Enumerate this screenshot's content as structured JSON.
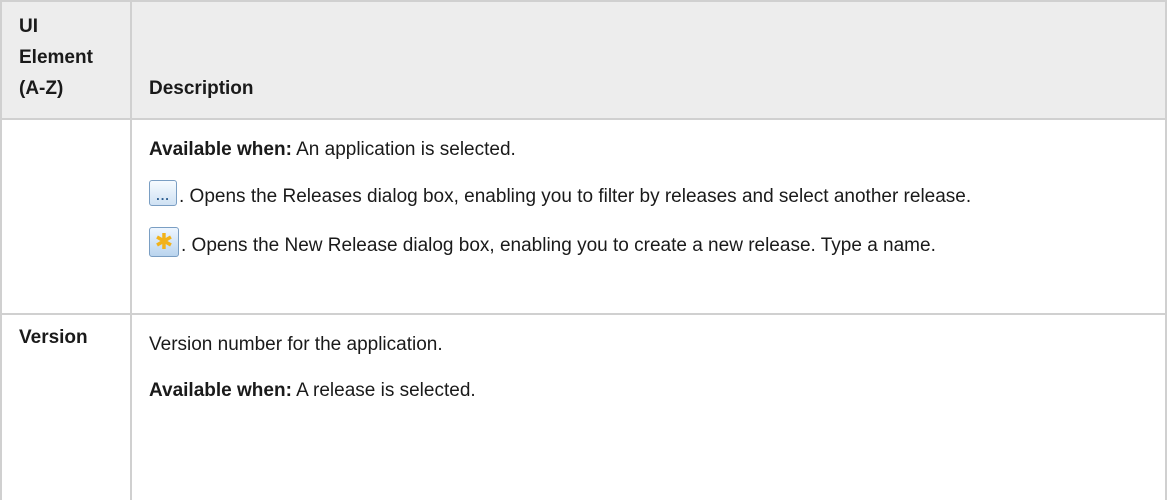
{
  "table": {
    "headers": {
      "element": "UI Element (A-Z)",
      "description": "Description"
    },
    "row1": {
      "element": "",
      "available_label": "Available when:",
      "available_text": " An application is selected.",
      "browse_icon": "ellipsis-browse-icon",
      "browse_text": ". Opens the Releases dialog box, enabling you to filter by releases and select another release.",
      "new_icon": "new-release-star-icon",
      "new_text": ". Opens the New Release dialog box, enabling you to create a new release. Type a name."
    },
    "row2": {
      "element": "Version",
      "desc": "Version number for the application.",
      "available_label": "Available when:",
      "available_text": " A release is selected."
    }
  }
}
